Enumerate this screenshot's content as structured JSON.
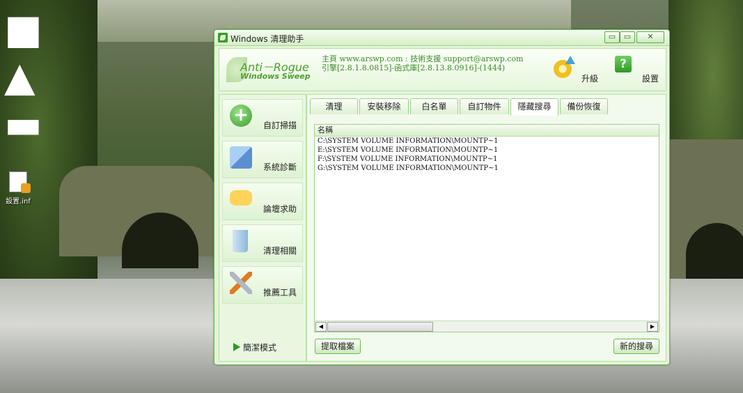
{
  "desktop": {
    "icon_label": "設置.inf"
  },
  "window": {
    "title": "Windows 清理助手",
    "btn_min": "▭",
    "btn_max": "▭",
    "btn_close": "✕"
  },
  "header": {
    "logo_line1": "Anti－Rogue",
    "logo_line2": "Windows Sweep",
    "info_line1": "主頁 www.arswp.com : 技術支援 support@arswp.com",
    "info_line2": "引擎[2.8.1.8.0815]-函式庫[2.8.13.8.0916]-(1444)",
    "upgrade_label": "升級",
    "settings_label": "設置",
    "settings_glyph": "?"
  },
  "sidebar": {
    "items": [
      {
        "label": "自訂掃描",
        "icon": "plus-icon",
        "glyph": "+"
      },
      {
        "label": "系統診斷",
        "icon": "diagnose-icon"
      },
      {
        "label": "論壇求助",
        "icon": "chat-icon"
      },
      {
        "label": "清理相關",
        "icon": "recycle-bin-icon"
      },
      {
        "label": "推薦工具",
        "icon": "tools-icon"
      }
    ],
    "simple_mode": "簡潔模式"
  },
  "tabs": [
    "清理",
    "安裝移除",
    "白名單",
    "自訂物件",
    "隱藏搜尋",
    "備份恢復"
  ],
  "active_tab": "隱藏搜尋",
  "list": {
    "header": "名稱",
    "rows": [
      "C:\\SYSTEM VOLUME INFORMATION\\MOUNTP~1",
      "E:\\SYSTEM VOLUME INFORMATION\\MOUNTP~1",
      "F:\\SYSTEM VOLUME INFORMATION\\MOUNTP~1",
      "G:\\SYSTEM VOLUME INFORMATION\\MOUNTP~1"
    ],
    "scroll_left": "◀",
    "scroll_right": "▶"
  },
  "buttons": {
    "extract": "提取檔案",
    "new_search": "新的搜尋"
  },
  "desktop_glyphs": [
    "■",
    "▲",
    "▬"
  ]
}
